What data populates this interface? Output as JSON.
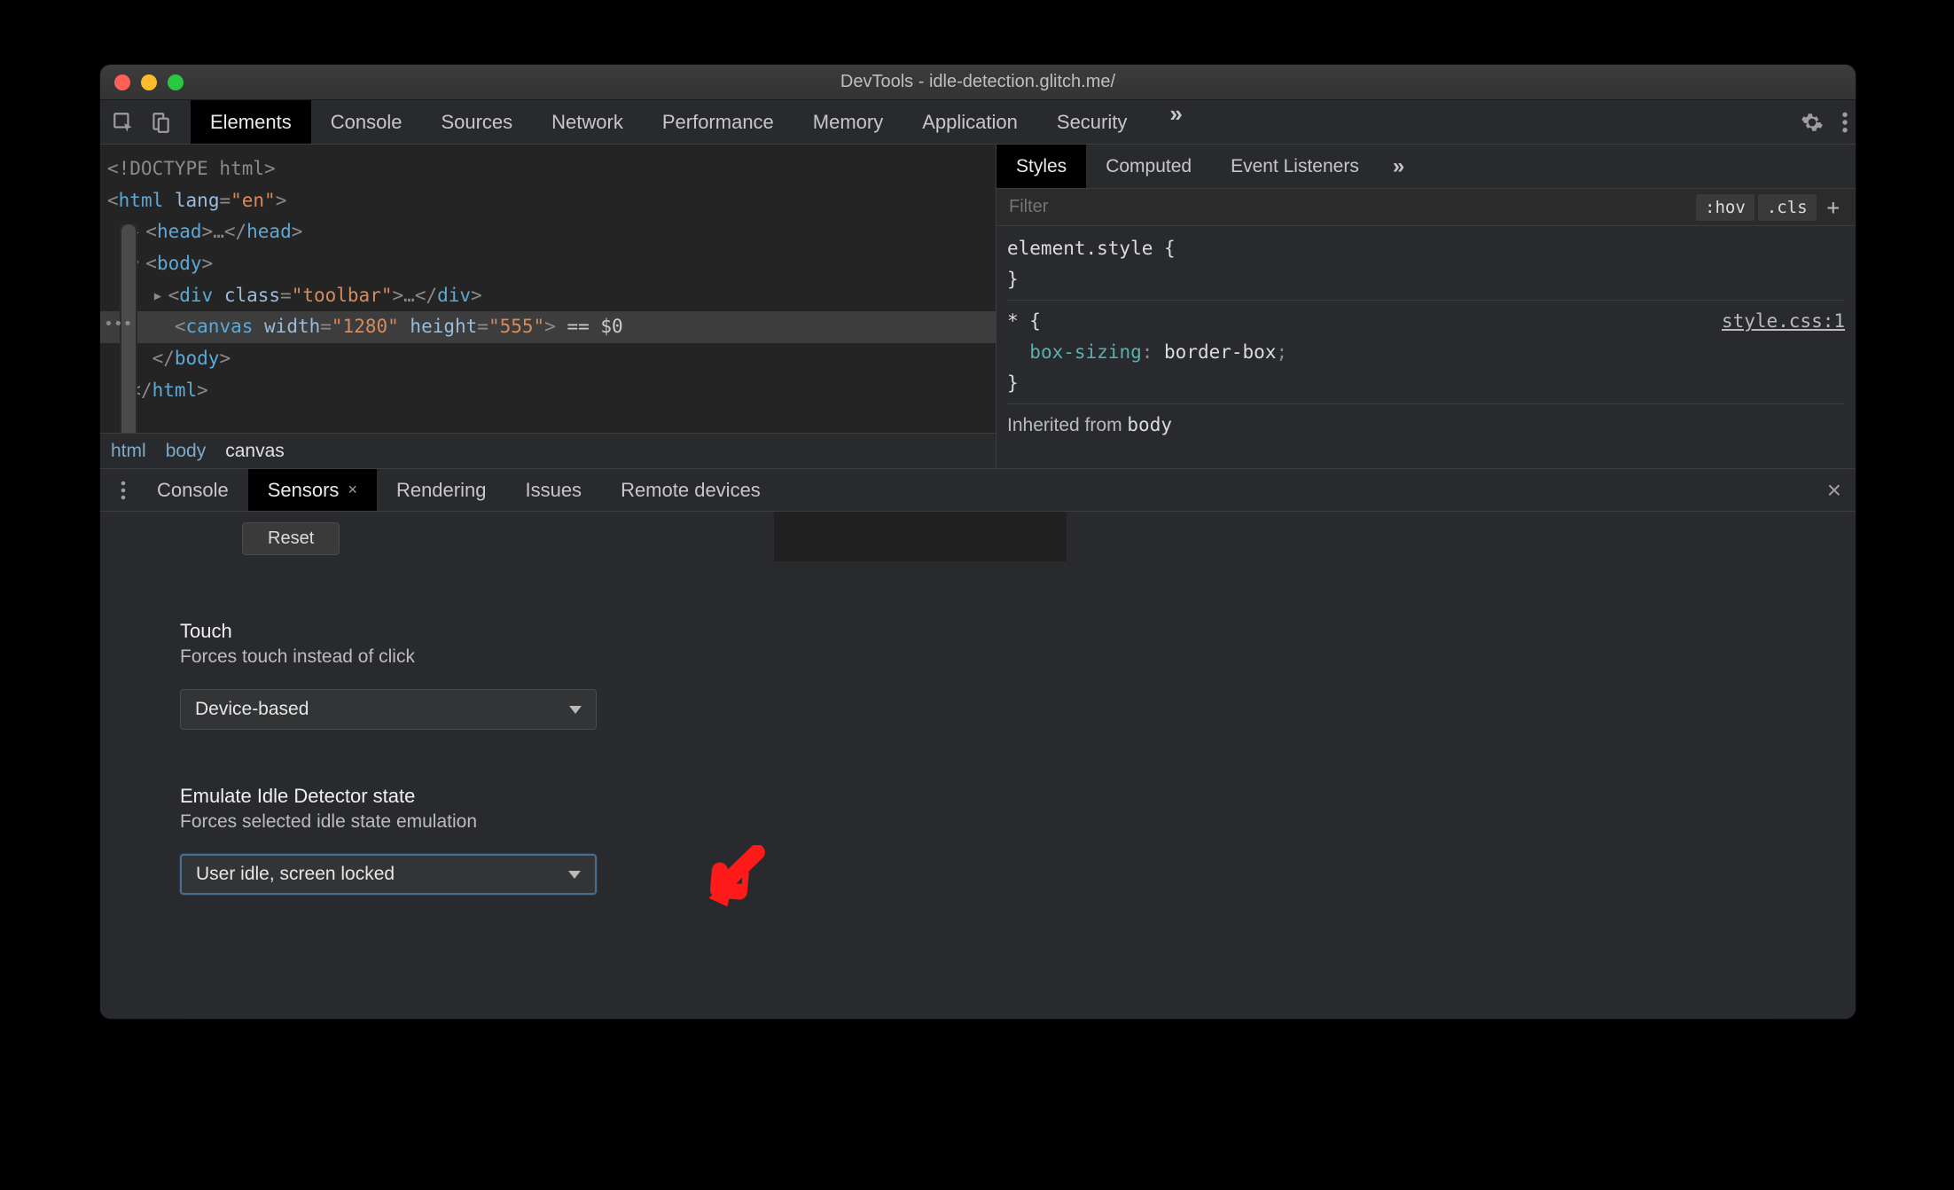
{
  "window": {
    "title": "DevTools - idle-detection.glitch.me/"
  },
  "toolbar": {
    "tabs": [
      "Elements",
      "Console",
      "Sources",
      "Network",
      "Performance",
      "Memory",
      "Application",
      "Security"
    ],
    "active_tab": "Elements",
    "overflow_glyph": "»"
  },
  "dom": {
    "line0_doctype": "<!DOCTYPE html>",
    "line1_open_html": "html",
    "line1_attr": "lang",
    "line1_val": "\"en\"",
    "line2_head_open": "head",
    "line2_ellipsis": "…",
    "line3_body": "body",
    "line4_div_tag": "div",
    "line4_attr": "class",
    "line4_val": "\"toolbar\"",
    "line4_ellipsis": "…",
    "line5_canvas": "canvas",
    "line5_attr_w": "width",
    "line5_val_w": "\"1280\"",
    "line5_attr_h": "height",
    "line5_val_h": "\"555\"",
    "line5_selected": " == $0",
    "line6_close_body": "body",
    "line7_close_html": "html",
    "overflow_dots": "•••"
  },
  "breadcrumbs": [
    "html",
    "body",
    "canvas"
  ],
  "breadcrumb_active": "canvas",
  "styles": {
    "tabs": [
      "Styles",
      "Computed",
      "Event Listeners"
    ],
    "active_tab": "Styles",
    "overflow_glyph": "»",
    "filter_placeholder": "Filter",
    "chips": [
      ":hov",
      ".cls"
    ],
    "plus": "+",
    "rule1_selector": "element.style",
    "rule1_open": " {",
    "rule1_close": "}",
    "rule2_selector": "*",
    "rule2_open": " {",
    "rule2_prop": "box-sizing",
    "rule2_val": "border-box",
    "rule2_close": "}",
    "rule2_src": "style.css:1",
    "inherited_label": "Inherited from ",
    "inherited_from": "body"
  },
  "drawer": {
    "tabs": [
      "Console",
      "Sensors",
      "Rendering",
      "Issues",
      "Remote devices"
    ],
    "active_tab": "Sensors",
    "close_glyph": "×",
    "reset_label": "Reset",
    "touch": {
      "title": "Touch",
      "subtitle": "Forces touch instead of click",
      "value": "Device-based"
    },
    "idle": {
      "title": "Emulate Idle Detector state",
      "subtitle": "Forces selected idle state emulation",
      "value": "User idle, screen locked"
    }
  },
  "annotation": {
    "color": "#ff1a1a"
  }
}
